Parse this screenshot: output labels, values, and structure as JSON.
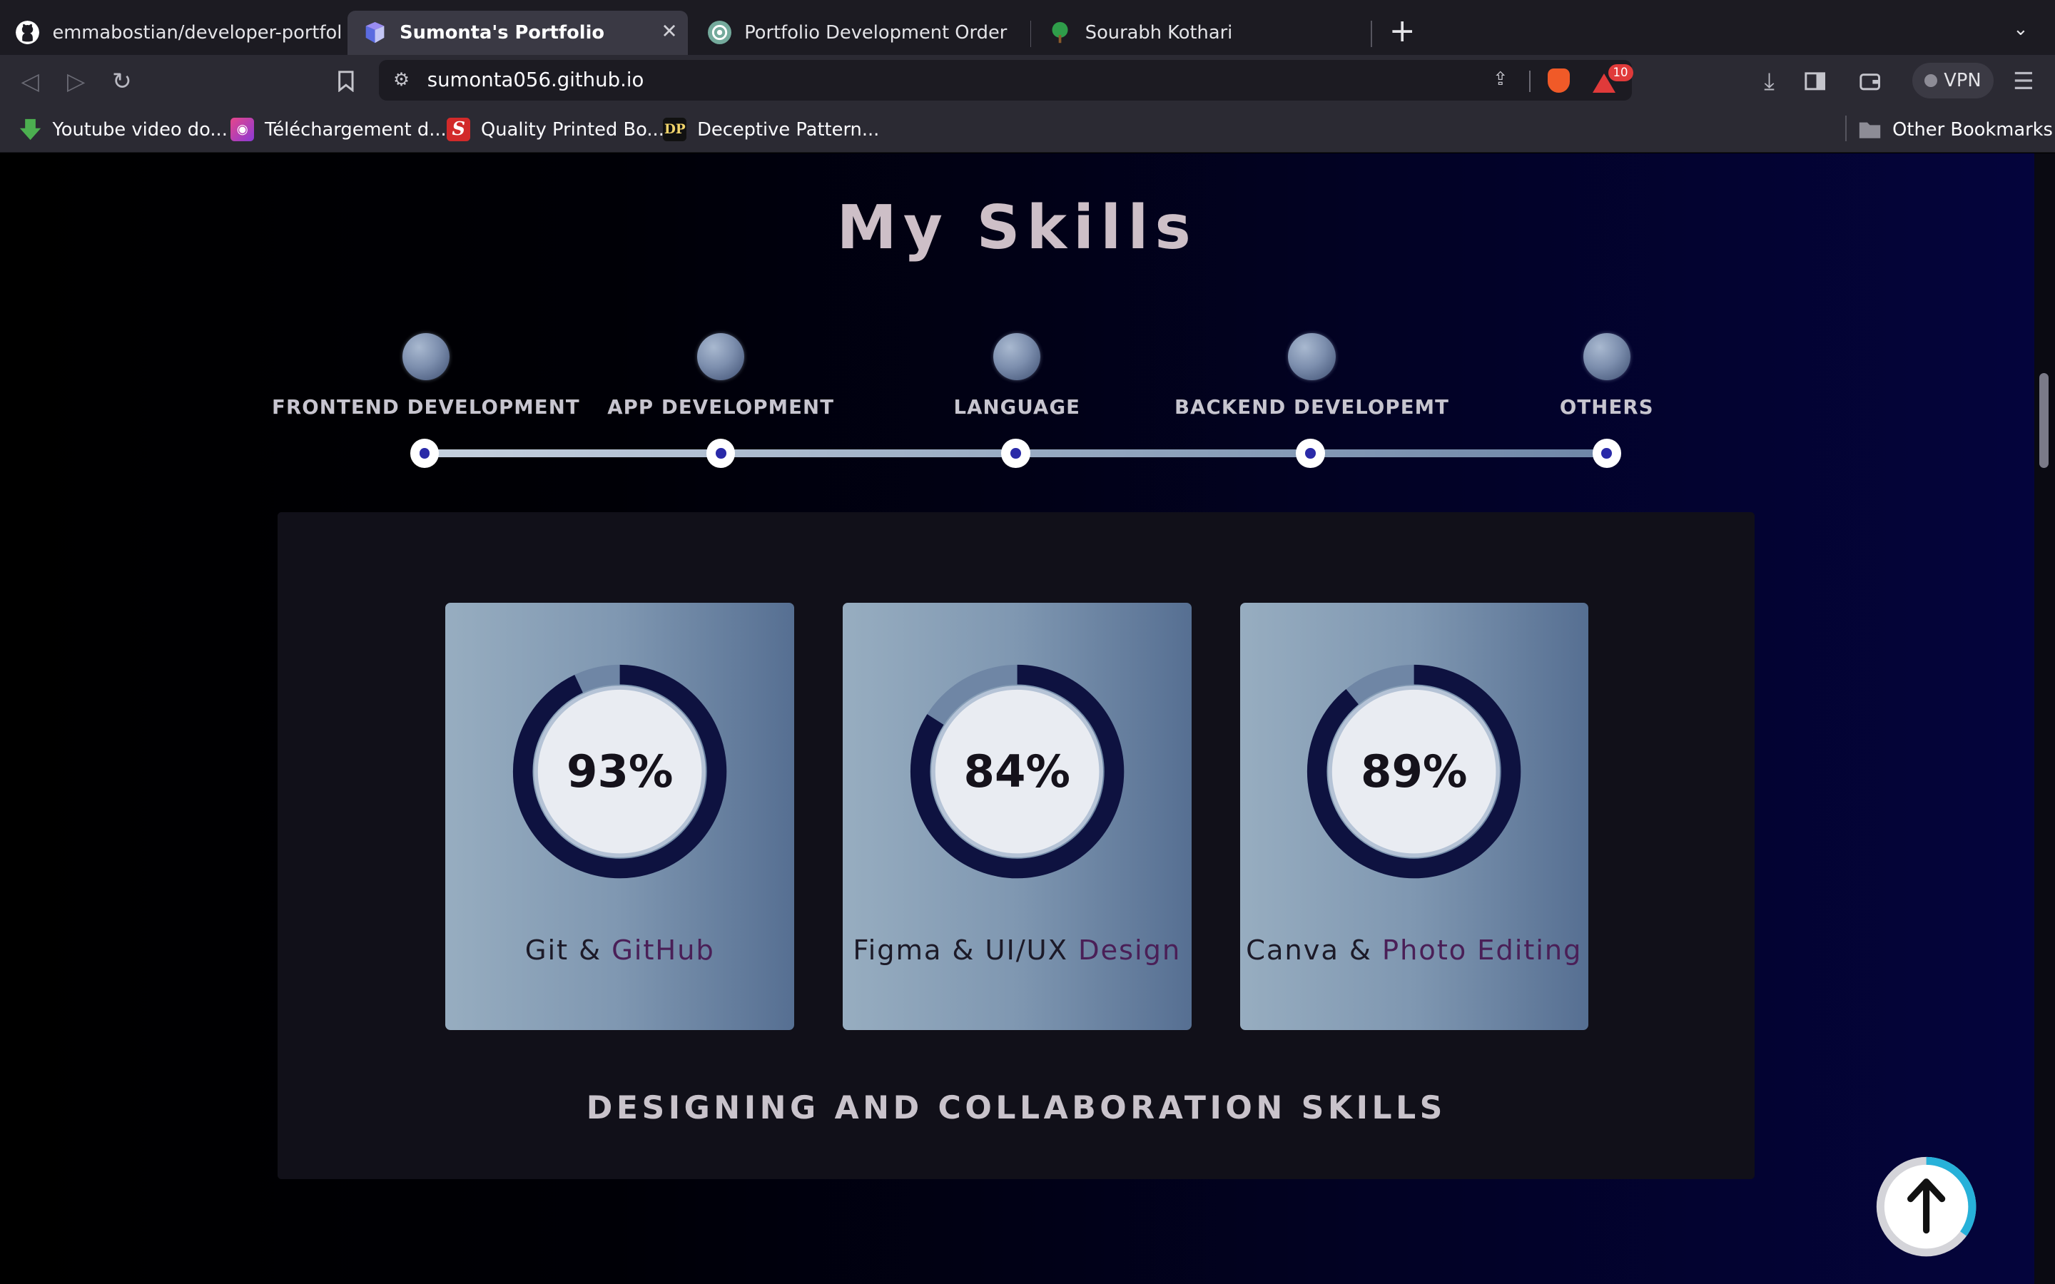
{
  "browser": {
    "tabs": [
      {
        "title": "emmabostian/developer-portfolios:",
        "active": false,
        "favicon": "github-icon"
      },
      {
        "title": "Sumonta's Portfolio",
        "active": true,
        "favicon": "portfolio-icon"
      },
      {
        "title": "Portfolio Development Order",
        "active": false,
        "favicon": "chatgpt-icon"
      },
      {
        "title": "Sourabh Kothari",
        "active": false,
        "favicon": "tree-icon"
      }
    ],
    "new_tab": "+",
    "url": "sumonta056.github.io",
    "rewards_badge": "10",
    "vpn_label": "VPN",
    "bookmarks": [
      {
        "label": "Youtube video do...",
        "icon": "download-arrow-icon"
      },
      {
        "label": "Téléchargement d...",
        "icon": "camera-icon"
      },
      {
        "label": "Quality Printed Bo...",
        "icon": "s-logo-icon"
      },
      {
        "label": "Deceptive Pattern...",
        "icon": "dp-logo-icon",
        "icon_text": "DP"
      }
    ],
    "other_bookmarks": "Other Bookmarks"
  },
  "skills": {
    "title": "My Skills",
    "categories": [
      {
        "label": "FRONTEND DEVELOPMENT"
      },
      {
        "label": "APP DEVELOPMENT"
      },
      {
        "label": "LANGUAGE"
      },
      {
        "label": "BACKEND DEVELOPEMT"
      },
      {
        "label": "OTHERS"
      }
    ],
    "cards": [
      {
        "percent": 93,
        "percent_label": "93%",
        "label_main": "Git & ",
        "label_accent": "GitHub"
      },
      {
        "percent": 84,
        "percent_label": "84%",
        "label_main": "Figma & UI/UX ",
        "label_accent": "Design"
      },
      {
        "percent": 89,
        "percent_label": "89%",
        "label_main": "Canva & ",
        "label_accent": "Photo Editing"
      }
    ],
    "panel_caption": "DESIGNING AND COLLABORATION SKILLS"
  },
  "scroll_progress": 0.35,
  "colors": {
    "ring_progress": "#0e1240",
    "ring_track": "#6f86a5",
    "ring_inner": "#e9ecf2",
    "accent_text": "#4a1f57",
    "scroll_ring": "#27b1d9"
  }
}
